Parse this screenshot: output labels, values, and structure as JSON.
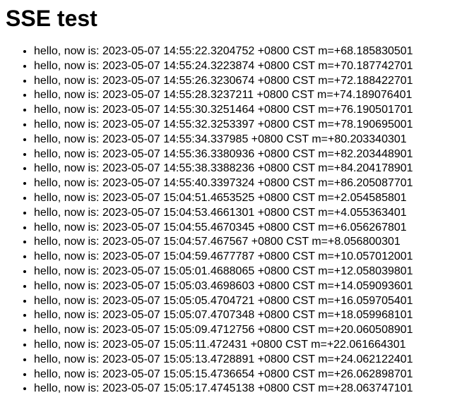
{
  "title": "SSE test",
  "items": [
    "hello, now is: 2023-05-07 14:55:22.3204752 +0800 CST m=+68.185830501",
    "hello, now is: 2023-05-07 14:55:24.3223874 +0800 CST m=+70.187742701",
    "hello, now is: 2023-05-07 14:55:26.3230674 +0800 CST m=+72.188422701",
    "hello, now is: 2023-05-07 14:55:28.3237211 +0800 CST m=+74.189076401",
    "hello, now is: 2023-05-07 14:55:30.3251464 +0800 CST m=+76.190501701",
    "hello, now is: 2023-05-07 14:55:32.3253397 +0800 CST m=+78.190695001",
    "hello, now is: 2023-05-07 14:55:34.337985 +0800 CST m=+80.203340301",
    "hello, now is: 2023-05-07 14:55:36.3380936 +0800 CST m=+82.203448901",
    "hello, now is: 2023-05-07 14:55:38.3388236 +0800 CST m=+84.204178901",
    "hello, now is: 2023-05-07 14:55:40.3397324 +0800 CST m=+86.205087701",
    "hello, now is: 2023-05-07 15:04:51.4653525 +0800 CST m=+2.054585801",
    "hello, now is: 2023-05-07 15:04:53.4661301 +0800 CST m=+4.055363401",
    "hello, now is: 2023-05-07 15:04:55.4670345 +0800 CST m=+6.056267801",
    "hello, now is: 2023-05-07 15:04:57.467567 +0800 CST m=+8.056800301",
    "hello, now is: 2023-05-07 15:04:59.4677787 +0800 CST m=+10.057012001",
    "hello, now is: 2023-05-07 15:05:01.4688065 +0800 CST m=+12.058039801",
    "hello, now is: 2023-05-07 15:05:03.4698603 +0800 CST m=+14.059093601",
    "hello, now is: 2023-05-07 15:05:05.4704721 +0800 CST m=+16.059705401",
    "hello, now is: 2023-05-07 15:05:07.4707348 +0800 CST m=+18.059968101",
    "hello, now is: 2023-05-07 15:05:09.4712756 +0800 CST m=+20.060508901",
    "hello, now is: 2023-05-07 15:05:11.472431 +0800 CST m=+22.061664301",
    "hello, now is: 2023-05-07 15:05:13.4728891 +0800 CST m=+24.062122401",
    "hello, now is: 2023-05-07 15:05:15.4736654 +0800 CST m=+26.062898701",
    "hello, now is: 2023-05-07 15:05:17.4745138 +0800 CST m=+28.063747101"
  ]
}
